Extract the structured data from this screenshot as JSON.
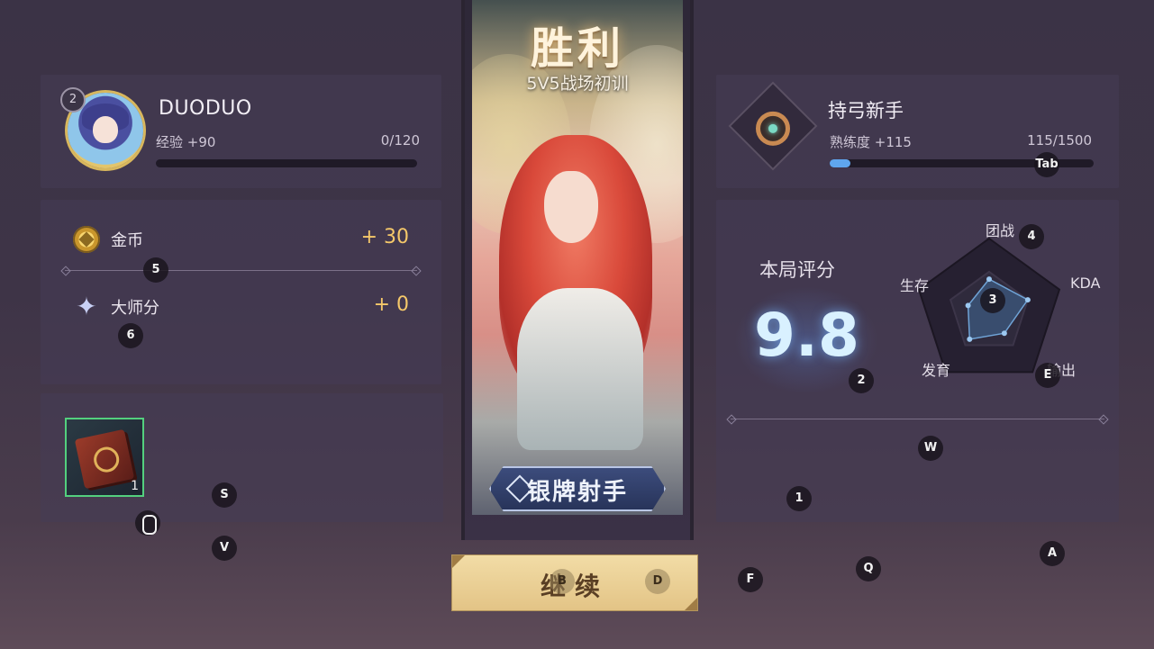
{
  "result": {
    "title": "胜利",
    "mode": "5V5战场初训"
  },
  "player": {
    "level": "2",
    "name": "DUODUO",
    "exp_label": "经验 +90",
    "exp_progress": "0/120",
    "exp_fraction": 0.0
  },
  "rewards": [
    {
      "icon": "gold-coin-icon",
      "label": "金币",
      "value": "+ 30"
    },
    {
      "icon": "master-star-icon",
      "label": "大师分",
      "value": "+ 0"
    }
  ],
  "items": [
    {
      "icon": "book-icon",
      "count": "1"
    }
  ],
  "hero_card": {
    "rank_label": "银牌射手"
  },
  "mastery": {
    "hero_title": "持弓新手",
    "label": "熟练度 +115",
    "progress": "115/1500",
    "fraction": 0.077
  },
  "score": {
    "label": "本局评分",
    "value": "9.8",
    "radar": {
      "axes": [
        "团战",
        "KDA",
        "输出",
        "发育",
        "生存"
      ],
      "values": [
        0.45,
        0.55,
        0.35,
        0.45,
        0.3
      ]
    }
  },
  "continue_button": {
    "label": "继续"
  },
  "key_hints": [
    "Tab",
    "4",
    "5",
    "3",
    "6",
    "2",
    "E",
    "W",
    "S",
    "1",
    "V",
    "A",
    "Q",
    "B",
    "D",
    "F"
  ],
  "colors": {
    "accent_blue": "#5fa6ee",
    "gold": "#f5c86a",
    "item_border": "#53d07e",
    "button_bg": "#e9cf94"
  }
}
